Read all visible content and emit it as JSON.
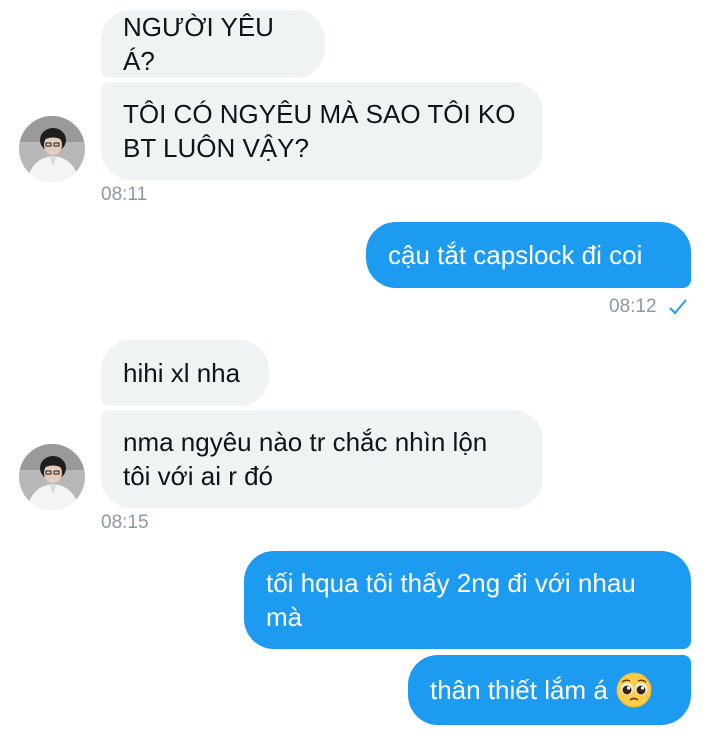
{
  "messages": [
    {
      "text": "NGƯỜI YÊU Á?"
    },
    {
      "text": "TÔI CÓ NGYÊU MÀ SAO TÔI KO\nBT LUÔN VẬY?"
    },
    {
      "time": "08:11"
    },
    {
      "text": "cậu tắt capslock đi coi"
    },
    {
      "time": "08:12"
    },
    {
      "text": "hihi xl nha"
    },
    {
      "text": "nma ngyêu nào tr chắc nhìn lộn\ntôi với ai r đó"
    },
    {
      "time": "08:15"
    },
    {
      "text": "tối hqua tôi thấy 2ng đi với nhau\nmà"
    },
    {
      "text": "thân thiết lắm á"
    }
  ],
  "colors": {
    "incoming_bubble": "#eff3f4",
    "outgoing_bubble": "#1d9bf0",
    "timestamp": "#8b98a5",
    "read_check": "#1d9bf0"
  },
  "icons": {
    "read_receipt": "check-icon",
    "emoji": "pleading-face-icon",
    "avatar": "avatar"
  }
}
